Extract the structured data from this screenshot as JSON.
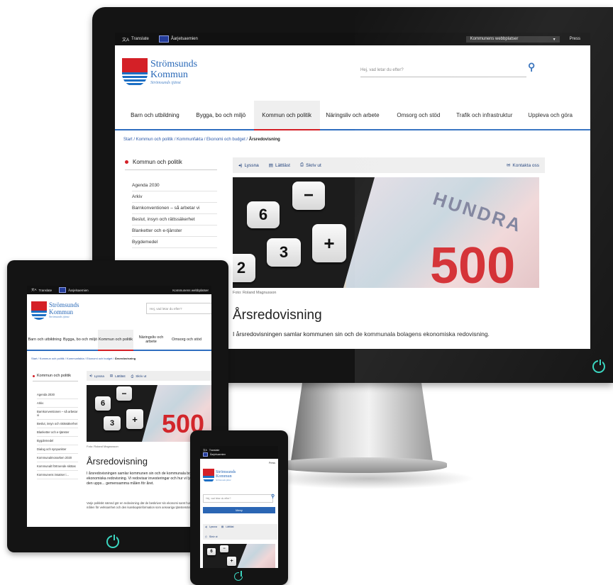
{
  "colors": {
    "accent_red": "#d42027",
    "brand_blue": "#2b6ab8",
    "nav_underline": "#2e6ec0",
    "power_led": "#3bd6c0",
    "topbar": "#111111"
  },
  "topbar": {
    "translate": "Translate",
    "language": "Åarjelsaemien",
    "dropdown": "Kommunens webbplatser",
    "press": "Press"
  },
  "logo": {
    "line1": "Strömsunds",
    "line2": "Kommun",
    "tagline": "Strömsunds tjänst"
  },
  "search": {
    "placeholder": "Hej, vad letar du efter?",
    "icon": "search-icon"
  },
  "nav": {
    "items": [
      {
        "label": "Barn och utbildning"
      },
      {
        "label": "Bygga, bo och miljö"
      },
      {
        "label": "Kommun och politik"
      },
      {
        "label": "Näringsliv och arbete"
      },
      {
        "label": "Omsorg och stöd"
      },
      {
        "label": "Trafik och infrastruktur"
      },
      {
        "label": "Uppleva och göra"
      }
    ],
    "active_index": 2
  },
  "breadcrumb": {
    "path": "Start / Kommun och politik / Kommunfakta / Ekonomi och budget / ",
    "current": "Årsredovisning"
  },
  "sidebar": {
    "title": "Kommun och politik",
    "items": [
      "Agenda 2030",
      "Arkiv",
      "Barnkonventionen – så arbetar vi",
      "Beslut, insyn och rättssäkerhet",
      "Blanketter och e-tjänster",
      "Bygdemedel",
      "Dialog och synpunkter",
      "Kommunalmonarken 2020",
      "Kommunalt förtroende skötas",
      "Kommunens insatser i..."
    ]
  },
  "toolbar": {
    "listen": "Lyssna",
    "easy_read": "Lättläst",
    "print": "Skriv ut",
    "contact": "Kontakta oss"
  },
  "hero": {
    "keys": [
      "6",
      "−",
      "3",
      "+",
      "2"
    ],
    "note_number": "500",
    "note_word": "HUNDRA",
    "caption": "Foto: Roland Magnusson"
  },
  "article": {
    "title": "Årsredovisning",
    "lead": "I årsredovisningen samlar kommunen sin och de kommunala bolagens ekonomiska redovisning.",
    "lead_tablet": "I årsredovisningen samlar kommunen sin och de kommunala bolagens ekonomiska redovisning. Vi redovisar investeringar och hur vi lyckats följa den upps... gemensamma målen för året.",
    "body_tablet": "Varje politiskt nämnd gör en redovisning där de beskriver sin ekonomi samt hur de uppfyllt målen för verksamhet och den kunskapsinformation som ansvariga tjänstemän."
  },
  "phone": {
    "menu_button": "Meny"
  }
}
